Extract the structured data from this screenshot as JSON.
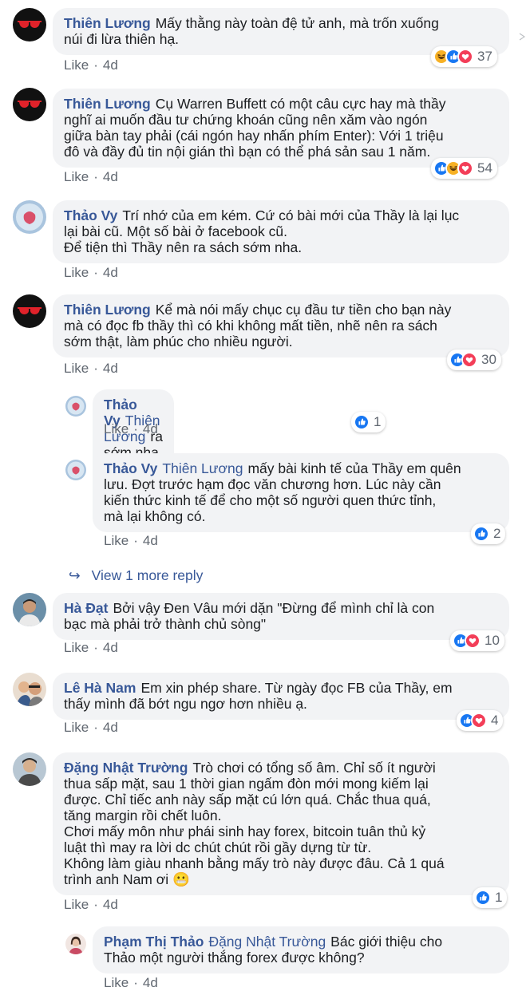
{
  "meta_labels": {
    "like": "Like",
    "dot": "·",
    "time": "4d"
  },
  "view_more": "View 1 more reply",
  "comments": [
    {
      "name": "Thiên Lương",
      "tag": "",
      "text": "Mấy thằng này toàn đệ tử anh, mà trốn xuống\nnúi đi lừa thiên hạ.",
      "count": "37",
      "reactions": [
        "haha",
        "like",
        "love"
      ]
    },
    {
      "name": "Thiên Lương",
      "tag": "",
      "text": "Cụ Warren Buffett có một câu cực hay mà thầy\nnghĩ ai muốn đầu tư chứng khoán cũng nên xăm vào ngón\ngiữa bàn tay phải (cái ngón hay nhấn phím Enter): Với 1 triệu\nđô và đầy đủ tin nội gián thì bạn có thể phá sản sau 1 năm.",
      "count": "54",
      "reactions": [
        "like",
        "haha",
        "love"
      ]
    },
    {
      "name": "Thảo Vy",
      "tag": "",
      "text": "Trí nhớ của em kém. Cứ có bài mới của Thầy là lại lục\nlại bài cũ. Một số bài ở facebook cũ.\nĐể tiện thì Thầy nên ra sách sớm nha.",
      "count": "",
      "reactions": []
    },
    {
      "name": "Thiên Lương",
      "tag": "",
      "text": "Kể mà nói mấy chục cụ đầu tư tiền cho bạn này\nmà có đọc fb thầy thì có khi không mất tiền, nhẽ nên ra sách\nsớm thật, làm phúc cho nhiều người.",
      "count": "30",
      "reactions": [
        "like",
        "love"
      ]
    },
    {
      "name": "Thảo Vy",
      "tag": "Thiên Lương",
      "text": "ra sớm nha Thầy.",
      "count": "1",
      "reactions": [
        "like"
      ]
    },
    {
      "name": "Thảo Vy",
      "tag": "Thiên Lương",
      "text": "mấy bài kinh tế của Thầy em quên\nlưu. Đợt trước hạm đọc văn chương hơn. Lúc này cần\nkiến thức kinh tế để cho một số người quen thức tỉnh,\nmà lại không có.",
      "count": "2",
      "reactions": [
        "like"
      ]
    },
    {
      "name": "Hà Đạt",
      "tag": "",
      "text": "Bởi vậy Đen Vâu mới dặn \"Đừng để mình chỉ là con\nbạc mà phải trở thành chủ sòng\"",
      "count": "10",
      "reactions": [
        "like",
        "love"
      ]
    },
    {
      "name": "Lê Hà Nam",
      "tag": "",
      "text": "Em xin phép share. Từ ngày đọc FB của Thầy, em\nthấy mình đã bớt ngu ngơ hơn nhiều ạ.",
      "count": "4",
      "reactions": [
        "like",
        "love"
      ]
    },
    {
      "name": "Đặng Nhật Trường",
      "tag": "",
      "text": "Trò chơi có tổng số âm. Chỉ số ít người\nthua sấp mặt, sau 1 thời gian ngấm đòn mới mong kiếm lại\nđược. Chỉ tiếc anh này sấp mặt cú lớn quá. Chắc thua quá,\ntăng margin rồi chết luôn.\nChơi mấy môn như phái sinh hay forex, bitcoin tuân thủ kỷ\nluật thì may ra lời dc chút chút rồi gầy dựng từ từ.\nKhông làm giàu nhanh bằng mấy trò này được đâu. Cả 1 quá\ntrình anh Nam ơi 😬",
      "count": "1",
      "reactions": [
        "like"
      ]
    },
    {
      "name": "Phạm Thị Thảo",
      "tag": "Đặng Nhật Trường",
      "text": "Bác giới thiệu cho\nThảo một người thắng forex được không?",
      "count": "",
      "reactions": []
    }
  ],
  "colors": {
    "link": "#385898",
    "bubble": "#f2f3f5",
    "meta": "#606770",
    "like": "#1877f2",
    "love": "#f33e58",
    "haha": "#f7b125"
  }
}
